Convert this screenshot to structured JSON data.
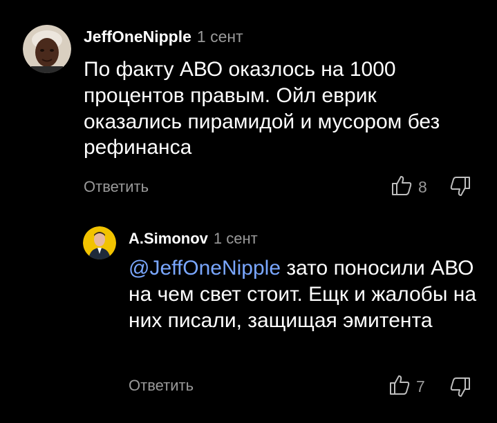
{
  "comments": [
    {
      "author": "JeffOneNipple",
      "date": "1 сент",
      "mention": "",
      "text": "По факту АВО оказлось на 1000 процентов правым. Ойл еврик оказались пирамидой и мусором без рефинанса",
      "reply_label": "Ответить",
      "likes": "8",
      "avatar_icon": "user-photo-avatar"
    },
    {
      "author": "A.Simonov",
      "date": "1 сент",
      "mention": "@JeffOneNipple",
      "text": " зато поносили АВО на чем свет стоит. Ещк и жалобы на них писали, защищая эмитента",
      "reply_label": "Ответить",
      "likes": "7",
      "avatar_icon": "user-photo-avatar"
    }
  ],
  "colors": {
    "background": "#000000",
    "text": "#ffffff",
    "secondary": "#9a9a9a",
    "mention": "#7aa7ff",
    "avatar2_bg": "#f2c300"
  },
  "icons": {
    "like": "thumbs-up-icon",
    "dislike": "thumbs-down-icon"
  }
}
